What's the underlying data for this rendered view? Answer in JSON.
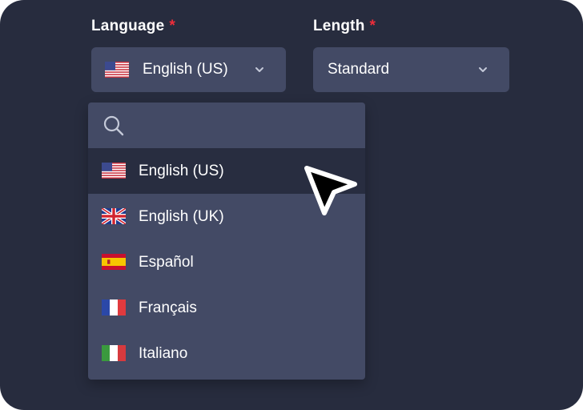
{
  "language": {
    "label": "Language",
    "required_mark": "*",
    "selected": "English (US)",
    "selected_flag": "us-flag-icon"
  },
  "length": {
    "label": "Length",
    "required_mark": "*",
    "selected": "Standard"
  },
  "dropdown": {
    "search_placeholder": "",
    "search_icon": "search-icon",
    "options": [
      {
        "label": "English (US)",
        "flag": "us-flag-icon",
        "selected": true
      },
      {
        "label": "English (UK)",
        "flag": "uk-flag-icon",
        "selected": false
      },
      {
        "label": "Español",
        "flag": "spain-flag-icon",
        "selected": false
      },
      {
        "label": "Français",
        "flag": "france-flag-icon",
        "selected": false
      },
      {
        "label": "Italiano",
        "flag": "italy-flag-icon",
        "selected": false
      }
    ]
  },
  "colors": {
    "background": "#272c3e",
    "control": "#434a65",
    "selected_option": "#282d40",
    "required": "#ef2d3a"
  }
}
